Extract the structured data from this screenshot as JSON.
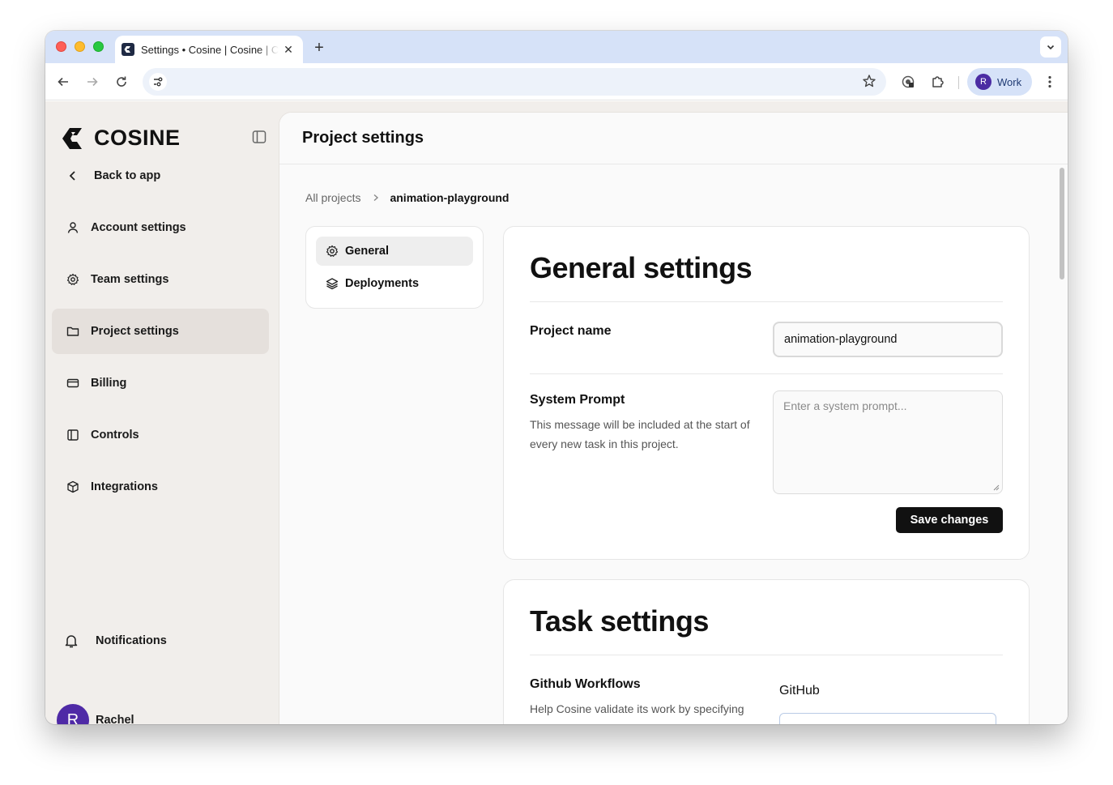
{
  "browser": {
    "tab_title": "Settings • Cosine | Cosine | Cosine",
    "profile_initial": "R",
    "profile_label": "Work",
    "url": ""
  },
  "sidebar": {
    "brand": "COSINE",
    "back_label": "Back to app",
    "items": [
      {
        "label": "Account settings",
        "icon": "user-icon"
      },
      {
        "label": "Team settings",
        "icon": "gear-icon"
      },
      {
        "label": "Project settings",
        "icon": "folder-icon",
        "active": true
      },
      {
        "label": "Billing",
        "icon": "credit-card-icon"
      },
      {
        "label": "Controls",
        "icon": "panel-icon"
      },
      {
        "label": "Integrations",
        "icon": "box-icon"
      }
    ],
    "notifications_label": "Notifications",
    "user_initial": "R",
    "user_name": "Rachel"
  },
  "main": {
    "title": "Project settings",
    "breadcrumb": {
      "root": "All projects",
      "current": "animation-playground"
    },
    "subnav": [
      {
        "label": "General",
        "active": true
      },
      {
        "label": "Deployments"
      }
    ]
  },
  "general": {
    "title": "General settings",
    "project_name_label": "Project name",
    "project_name_value": "animation-playground",
    "system_prompt_label": "System Prompt",
    "system_prompt_help": "This message will be included at the start of every new task in this project.",
    "system_prompt_placeholder": "Enter a system prompt...",
    "save_label": "Save changes"
  },
  "task": {
    "title": "Task settings",
    "workflows_label": "Github Workflows",
    "workflows_help": "Help Cosine validate its work by specifying which tests to",
    "github_label": "GitHub"
  },
  "colors": {
    "accent": "#111111",
    "avatar": "#4f2aa6",
    "sidebar_bg": "#f1eeeb"
  }
}
